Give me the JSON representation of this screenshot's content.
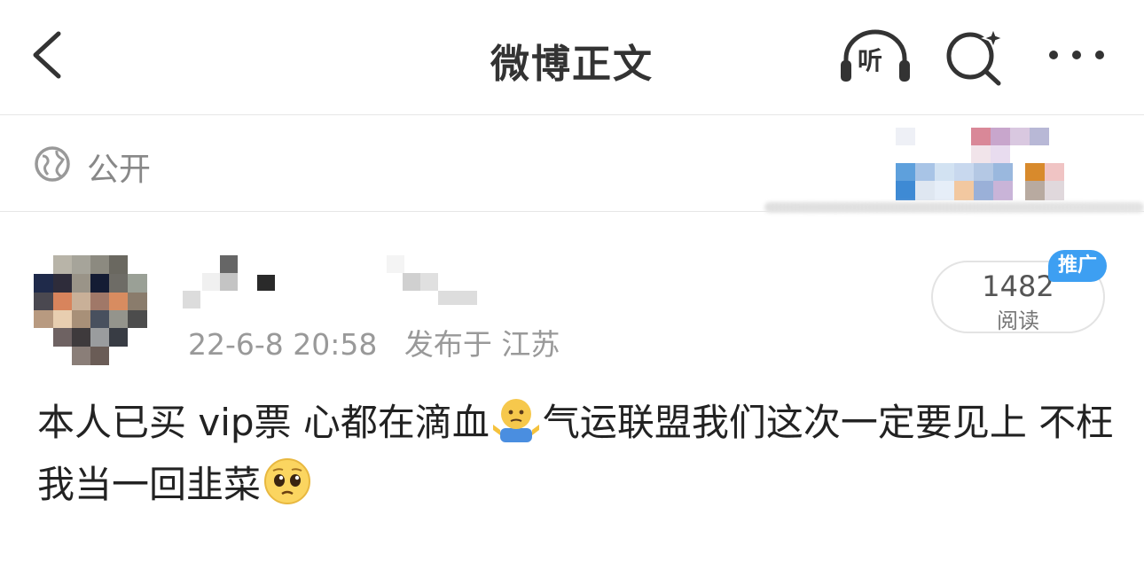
{
  "nav": {
    "title": "微博正文",
    "listen_label": "听",
    "icons": [
      "back-chevron-icon",
      "headphones-icon",
      "search-sparkle-icon",
      "more-dots-icon"
    ]
  },
  "visibility": {
    "icon": "globe-icon",
    "label": "公开"
  },
  "post": {
    "time": "22-6-8 20:58",
    "location": "发布于 江苏",
    "read_count": "1482",
    "read_label": "阅读",
    "promo_tag": "推广",
    "text_part1": "本人已买 vip票 心都在滴血",
    "text_part2": "气运联盟我们这次一定要见上 不枉我当一回韭菜",
    "emojis": [
      "shrug-emoji",
      "pleading-face-emoji"
    ]
  },
  "colors": {
    "accent_blue": "#3d9ff2",
    "text_primary": "#222222",
    "text_secondary": "#999999",
    "divider": "#e6e6e6"
  }
}
